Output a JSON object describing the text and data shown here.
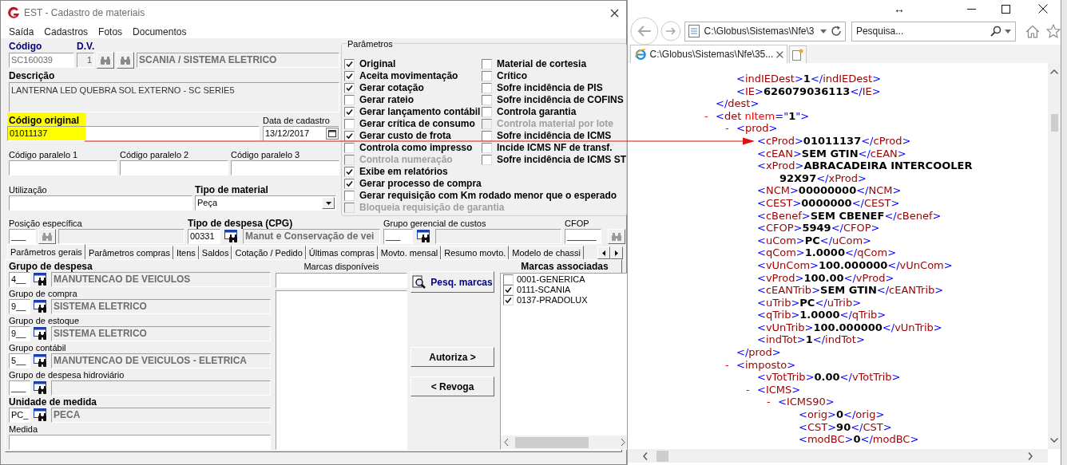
{
  "form_window": {
    "title": "EST - Cadastro de materiais",
    "menu": [
      "Saída",
      "Cadastros",
      "Fotos",
      "Documentos"
    ],
    "codigo": {
      "label": "Código",
      "value": "SC160039",
      "disabled": true
    },
    "dv": {
      "label": "D.V.",
      "value": "1",
      "disabled": true
    },
    "grupo_material": "SCANIA / SISTEMA ELETRICO",
    "descricao": {
      "label": "Descrição",
      "value": "LANTERNA LED QUEBRA SOL EXTERNO - SC SERIE5"
    },
    "codigo_original": {
      "label": "Código original",
      "value": "01011137",
      "highlighted": true
    },
    "data_cadastro": {
      "label": "Data de cadastro",
      "value": "13/12/2017"
    },
    "codigos_paralelos": [
      {
        "label": "Código paralelo 1"
      },
      {
        "label": "Código paralelo 2"
      },
      {
        "label": "Código paralelo 3"
      }
    ],
    "utilizacao": {
      "label": "Utilização"
    },
    "tipo_material": {
      "label": "Tipo de material",
      "value": "Peça"
    },
    "parametros": {
      "title": "Parâmetros",
      "columns": [
        [
          {
            "label": "Original",
            "checked": true,
            "disabled": false
          },
          {
            "label": "Aceita movimentação",
            "checked": true,
            "disabled": false
          },
          {
            "label": "Gerar cotação",
            "checked": true,
            "disabled": false
          },
          {
            "label": "Gerar rateio",
            "checked": false,
            "disabled": false
          },
          {
            "label": "Gerar lançamento contábil",
            "checked": true,
            "disabled": false
          },
          {
            "label": "Gerar crítica de consumo",
            "checked": false,
            "disabled": false
          },
          {
            "label": "Gerar custo de frota",
            "checked": true,
            "disabled": false
          },
          {
            "label": "Controla como impresso",
            "checked": false,
            "disabled": false
          },
          {
            "label": "Controla numeração",
            "checked": false,
            "disabled": true
          },
          {
            "label": "Exibe em relatórios",
            "checked": true,
            "disabled": false
          },
          {
            "label": "Gerar processo de compra",
            "checked": true,
            "disabled": false
          },
          {
            "label": "Gerar requisição com Km rodado menor que o esperado",
            "checked": false,
            "disabled": false
          },
          {
            "label": "Bloqueia requisição de garantia",
            "checked": false,
            "disabled": true
          }
        ],
        [
          {
            "label": "Material de cortesia",
            "checked": false,
            "disabled": false
          },
          {
            "label": "Crítico",
            "checked": false,
            "disabled": false
          },
          {
            "label": "Sofre incidência de PIS",
            "checked": false,
            "disabled": false
          },
          {
            "label": "Sofre incidência de COFINS",
            "checked": false,
            "disabled": false
          },
          {
            "label": "Controla garantia",
            "checked": false,
            "disabled": false
          },
          {
            "label": "Controla material por lote",
            "checked": false,
            "disabled": true
          },
          {
            "label": "Sofre incidência de ICMS",
            "checked": false,
            "disabled": false
          },
          {
            "label": "Incide ICMS NF de transf.",
            "checked": false,
            "disabled": false
          },
          {
            "label": "Sofre incidência de ICMS ST",
            "checked": false,
            "disabled": false
          }
        ]
      ]
    },
    "lookups": [
      {
        "label": "Posição específica",
        "bold": false,
        "kind": "full",
        "code": "___",
        "button_enabled": false
      },
      {
        "label": "Tipo de despesa (CPG)",
        "bold": true,
        "kind": "full",
        "code": "00331",
        "description": "Manut e Conservação de vei",
        "button_enabled": true
      },
      {
        "label": "Grupo gerencial de custos",
        "bold": false,
        "kind": "full",
        "code": "___",
        "button_enabled": true
      },
      {
        "label": "CFOP",
        "bold": false,
        "kind": "code_only",
        "code": "______",
        "button_enabled": false
      }
    ],
    "tabs": [
      {
        "label": "Parâmetros gerais",
        "selected": true
      },
      {
        "label": "Parâmetros compras",
        "selected": false
      },
      {
        "label": "Itens",
        "selected": false
      },
      {
        "label": "Saldos",
        "selected": false
      },
      {
        "label": "Cotação / Pedido",
        "selected": false
      },
      {
        "label": "Últimas compras",
        "selected": false
      },
      {
        "label": "Movto. mensal",
        "selected": false
      },
      {
        "label": "Resumo movto.",
        "selected": false
      },
      {
        "label": "Modelo de chassi",
        "selected": false
      }
    ],
    "grupos": [
      {
        "label": "Grupo de despesa",
        "bold": true,
        "code": "4__",
        "description": "MANUTENCAO DE VEICULOS"
      },
      {
        "label": "Grupo de compra",
        "bold": false,
        "code": "9__",
        "description": "SISTEMA ELETRICO"
      },
      {
        "label": "Grupo de estoque",
        "bold": false,
        "code": "9__",
        "description": "SISTEMA ELETRICO"
      },
      {
        "label": "Grupo contábil",
        "bold": false,
        "code": "5__",
        "description": "MANUTENCAO DE VEICULOS - ELETRICA"
      },
      {
        "label": "Grupo de despesa hidroviário",
        "bold": false,
        "code": "___"
      },
      {
        "label": "Unidade de medida",
        "bold": true,
        "code": "PC_",
        "description": "PECA"
      }
    ],
    "medida": {
      "label": "Medida"
    },
    "marcas_disponiveis": {
      "label": "Marcas disponíveis"
    },
    "buttons": {
      "search": "Pesq. marcas",
      "authorize": "Autoriza >",
      "revoke": "< Revoga"
    },
    "marcas_associadas": {
      "label": "Marcas associadas",
      "items": [
        {
          "label": "0001-GENERICA",
          "checked": false
        },
        {
          "label": "0111-SCANIA",
          "checked": true
        },
        {
          "label": "0137-PRADOLUX",
          "checked": true
        }
      ]
    }
  },
  "browser_window": {
    "resize_glyph": "↔",
    "address": "C:\\Globus\\Sistemas\\Nfe\\3",
    "search_placeholder": "Pesquisa...",
    "tab_title": "C:\\Globus\\Sistemas\\Nfe\\35...",
    "xml": [
      {
        "close": "</dest>",
        "children": [
          {
            "open": "<indIEDest>",
            "text": "1",
            "close": "</indIEDest>"
          },
          {
            "open": "<IE>",
            "text": "626079036113",
            "close": "</IE>"
          }
        ]
      },
      {
        "toggle": "-",
        "open": "<det nItem=\"1\">",
        "children": [
          {
            "toggle": "-",
            "open": "<prod>",
            "close": "</prod>",
            "children": [
              {
                "open": "<cProd>",
                "text": "01011137",
                "close": "</cProd>"
              },
              {
                "open": "<cEAN>",
                "text": "SEM GTIN",
                "close": "</cEAN>"
              },
              {
                "open": "<xProd>",
                "text": "ABRACADEIRA INTERCOOLER 92X97",
                "close": "</xProd>"
              },
              {
                "open": "<NCM>",
                "text": "00000000",
                "close": "</NCM>"
              },
              {
                "open": "<CEST>",
                "text": "0000000",
                "close": "</CEST>"
              },
              {
                "open": "<cBenef>",
                "text": "SEM CBENEF",
                "close": "</cBenef>"
              },
              {
                "open": "<CFOP>",
                "text": "5949",
                "close": "</CFOP>"
              },
              {
                "open": "<uCom>",
                "text": "PC",
                "close": "</uCom>"
              },
              {
                "open": "<qCom>",
                "text": "1.0000",
                "close": "</qCom>"
              },
              {
                "open": "<vUnCom>",
                "text": "100.000000",
                "close": "</vUnCom>"
              },
              {
                "open": "<vProd>",
                "text": "100.00",
                "close": "</vProd>"
              },
              {
                "open": "<cEANTrib>",
                "text": "SEM GTIN",
                "close": "</cEANTrib>"
              },
              {
                "open": "<uTrib>",
                "text": "PC",
                "close": "</uTrib>"
              },
              {
                "open": "<qTrib>",
                "text": "1.0000",
                "close": "</qTrib>"
              },
              {
                "open": "<vUnTrib>",
                "text": "100.000000",
                "close": "</vUnTrib>"
              },
              {
                "open": "<indTot>",
                "text": "1",
                "close": "</indTot>"
              }
            ]
          },
          {
            "toggle": "-",
            "open": "<imposto>",
            "children": [
              {
                "open": "<vTotTrib>",
                "text": "0.00",
                "close": "</vTotTrib>"
              },
              {
                "toggle": "-",
                "open": "<ICMS>",
                "children": [
                  {
                    "toggle": "-",
                    "open": "<ICMS90>",
                    "children": [
                      {
                        "open": "<orig>",
                        "text": "0",
                        "close": "</orig>"
                      },
                      {
                        "open": "<CST>",
                        "text": "90",
                        "close": "</CST>"
                      },
                      {
                        "open": "<modBC>",
                        "text": "0",
                        "close": "</modBC>"
                      }
                    ]
                  }
                ]
              }
            ]
          }
        ]
      }
    ]
  }
}
